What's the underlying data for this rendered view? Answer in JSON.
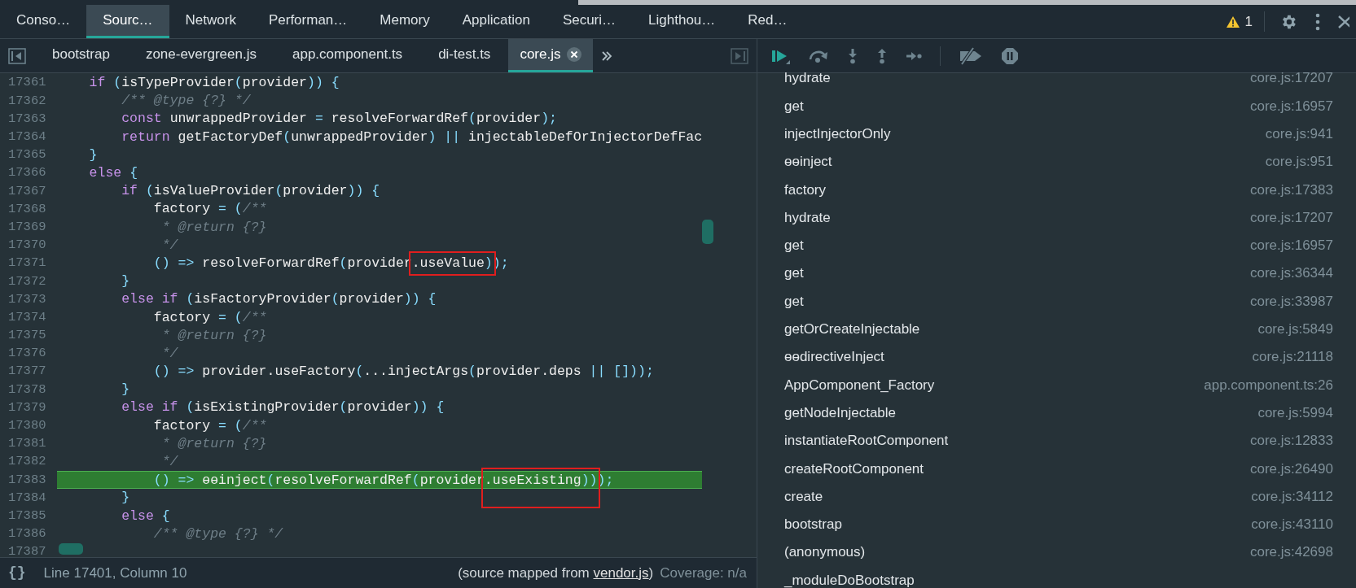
{
  "panel_tabs": [
    {
      "label": "Conso…",
      "selected": false
    },
    {
      "label": "Sourc…",
      "selected": true
    },
    {
      "label": "Network",
      "selected": false
    },
    {
      "label": "Performan…",
      "selected": false
    },
    {
      "label": "Memory",
      "selected": false
    },
    {
      "label": "Application",
      "selected": false
    },
    {
      "label": "Securi…",
      "selected": false
    },
    {
      "label": "Lighthou…",
      "selected": false
    },
    {
      "label": "Red…",
      "selected": false
    }
  ],
  "warnings": {
    "count": "1"
  },
  "file_tabs": [
    {
      "label": "bootstrap",
      "selected": false
    },
    {
      "label": "zone-evergreen.js",
      "selected": false
    },
    {
      "label": "app.component.ts",
      "selected": false
    },
    {
      "label": "di-test.ts",
      "selected": false
    },
    {
      "label": "core.js",
      "selected": true
    }
  ],
  "code": {
    "lines": [
      {
        "number": "17361",
        "current": false,
        "tokens": [
          {
            "kind": "keyword",
            "text": "    if"
          },
          {
            "kind": "code",
            "text": " (isTypeProvider(provider)) {"
          }
        ]
      },
      {
        "number": "17362",
        "current": false,
        "tokens": [
          {
            "kind": "comment",
            "text": "        /** @type {?} */"
          }
        ]
      },
      {
        "number": "17363",
        "current": false,
        "tokens": [
          {
            "kind": "keyword",
            "text": "        const"
          },
          {
            "kind": "code",
            "text": " unwrappedProvider = resolveForwardRef(provider);"
          }
        ]
      },
      {
        "number": "17364",
        "current": false,
        "tokens": [
          {
            "kind": "keyword",
            "text": "        return"
          },
          {
            "kind": "code",
            "text": " getFactoryDef(unwrappedProvider) || injectableDefOrInjectorDefFac"
          }
        ]
      },
      {
        "number": "17365",
        "current": false,
        "tokens": [
          {
            "kind": "code",
            "text": "    }"
          }
        ]
      },
      {
        "number": "17366",
        "current": false,
        "tokens": [
          {
            "kind": "keyword",
            "text": "    else"
          },
          {
            "kind": "code",
            "text": " {"
          }
        ]
      },
      {
        "number": "17367",
        "current": false,
        "tokens": [
          {
            "kind": "keyword",
            "text": "        if"
          },
          {
            "kind": "code",
            "text": " (isValueProvider(provider)) {"
          }
        ]
      },
      {
        "number": "17368",
        "current": false,
        "tokens": [
          {
            "kind": "code",
            "text": "            factory = ("
          },
          {
            "kind": "comment",
            "text": "/**"
          }
        ]
      },
      {
        "number": "17369",
        "current": false,
        "tokens": [
          {
            "kind": "comment",
            "text": "             * @return {?}"
          }
        ]
      },
      {
        "number": "17370",
        "current": false,
        "tokens": [
          {
            "kind": "comment",
            "text": "             */"
          }
        ]
      },
      {
        "number": "17371",
        "current": false,
        "tokens": [
          {
            "kind": "code",
            "text": "            () => resolveForwardRef(provider"
          },
          {
            "kind": "code",
            "text": ".useValue)",
            "boxed": true
          },
          {
            "kind": "code",
            "text": ");"
          }
        ]
      },
      {
        "number": "17372",
        "current": false,
        "tokens": [
          {
            "kind": "code",
            "text": "        }"
          }
        ]
      },
      {
        "number": "17373",
        "current": false,
        "tokens": [
          {
            "kind": "keyword",
            "text": "        else if"
          },
          {
            "kind": "code",
            "text": " (isFactoryProvider(provider)) {"
          }
        ]
      },
      {
        "number": "17374",
        "current": false,
        "tokens": [
          {
            "kind": "code",
            "text": "            factory = ("
          },
          {
            "kind": "comment",
            "text": "/**"
          }
        ]
      },
      {
        "number": "17375",
        "current": false,
        "tokens": [
          {
            "kind": "comment",
            "text": "             * @return {?}"
          }
        ]
      },
      {
        "number": "17376",
        "current": false,
        "tokens": [
          {
            "kind": "comment",
            "text": "             */"
          }
        ]
      },
      {
        "number": "17377",
        "current": false,
        "tokens": [
          {
            "kind": "code",
            "text": "            () => provider.useFactory(...injectArgs(provider.deps || []));"
          }
        ]
      },
      {
        "number": "17378",
        "current": false,
        "tokens": [
          {
            "kind": "code",
            "text": "        }"
          }
        ]
      },
      {
        "number": "17379",
        "current": false,
        "tokens": [
          {
            "kind": "keyword",
            "text": "        else if"
          },
          {
            "kind": "code",
            "text": " (isExistingProvider(provider)) {"
          }
        ]
      },
      {
        "number": "17380",
        "current": false,
        "tokens": [
          {
            "kind": "code",
            "text": "            factory = ("
          },
          {
            "kind": "comment",
            "text": "/**"
          }
        ]
      },
      {
        "number": "17381",
        "current": false,
        "tokens": [
          {
            "kind": "comment",
            "text": "             * @return {?}"
          }
        ]
      },
      {
        "number": "17382",
        "current": false,
        "tokens": [
          {
            "kind": "comment",
            "text": "             */"
          }
        ]
      },
      {
        "number": "17383",
        "current": true,
        "tokens": [
          {
            "kind": "code",
            "text": "            () => ɵɵinject(resolveForwardRef(provider"
          },
          {
            "kind": "code",
            "text": ".useExisting))",
            "boxed": true
          },
          {
            "kind": "code",
            "text": ");"
          }
        ]
      },
      {
        "number": "17384",
        "current": false,
        "tokens": [
          {
            "kind": "code",
            "text": "        }"
          }
        ]
      },
      {
        "number": "17385",
        "current": false,
        "tokens": [
          {
            "kind": "keyword",
            "text": "        else"
          },
          {
            "kind": "code",
            "text": " {"
          }
        ]
      },
      {
        "number": "17386",
        "current": false,
        "tokens": [
          {
            "kind": "comment",
            "text": "            /** @type {?} */"
          }
        ]
      },
      {
        "number": "17387",
        "current": false
      }
    ]
  },
  "status_bar": {
    "format_button": "{}",
    "position": "Line 17401, Column 10",
    "source_prefix": "(source mapped from ",
    "source_link": "vendor.js",
    "source_suffix": ")",
    "coverage": "Coverage: n/a"
  },
  "call_stack": [
    {
      "name": "hydrate",
      "location": "core.js:17207"
    },
    {
      "name": "get",
      "location": "core.js:16957"
    },
    {
      "name": "injectInjectorOnly",
      "location": "core.js:941"
    },
    {
      "name": "ɵɵinject",
      "location": "core.js:951"
    },
    {
      "name": "factory",
      "location": "core.js:17383"
    },
    {
      "name": "hydrate",
      "location": "core.js:17207"
    },
    {
      "name": "get",
      "location": "core.js:16957"
    },
    {
      "name": "get",
      "location": "core.js:36344"
    },
    {
      "name": "get",
      "location": "core.js:33987"
    },
    {
      "name": "getOrCreateInjectable",
      "location": "core.js:5849"
    },
    {
      "name": "ɵɵdirectiveInject",
      "location": "core.js:21118"
    },
    {
      "name": "AppComponent_Factory",
      "location": "app.component.ts:26"
    },
    {
      "name": "getNodeInjectable",
      "location": "core.js:5994"
    },
    {
      "name": "instantiateRootComponent",
      "location": "core.js:12833"
    },
    {
      "name": "createRootComponent",
      "location": "core.js:26490"
    },
    {
      "name": "create",
      "location": "core.js:34112"
    },
    {
      "name": "bootstrap",
      "location": "core.js:43110"
    },
    {
      "name": "(anonymous)",
      "location": "core.js:42698"
    },
    {
      "name": "_moduleDoBootstrap"
    }
  ]
}
